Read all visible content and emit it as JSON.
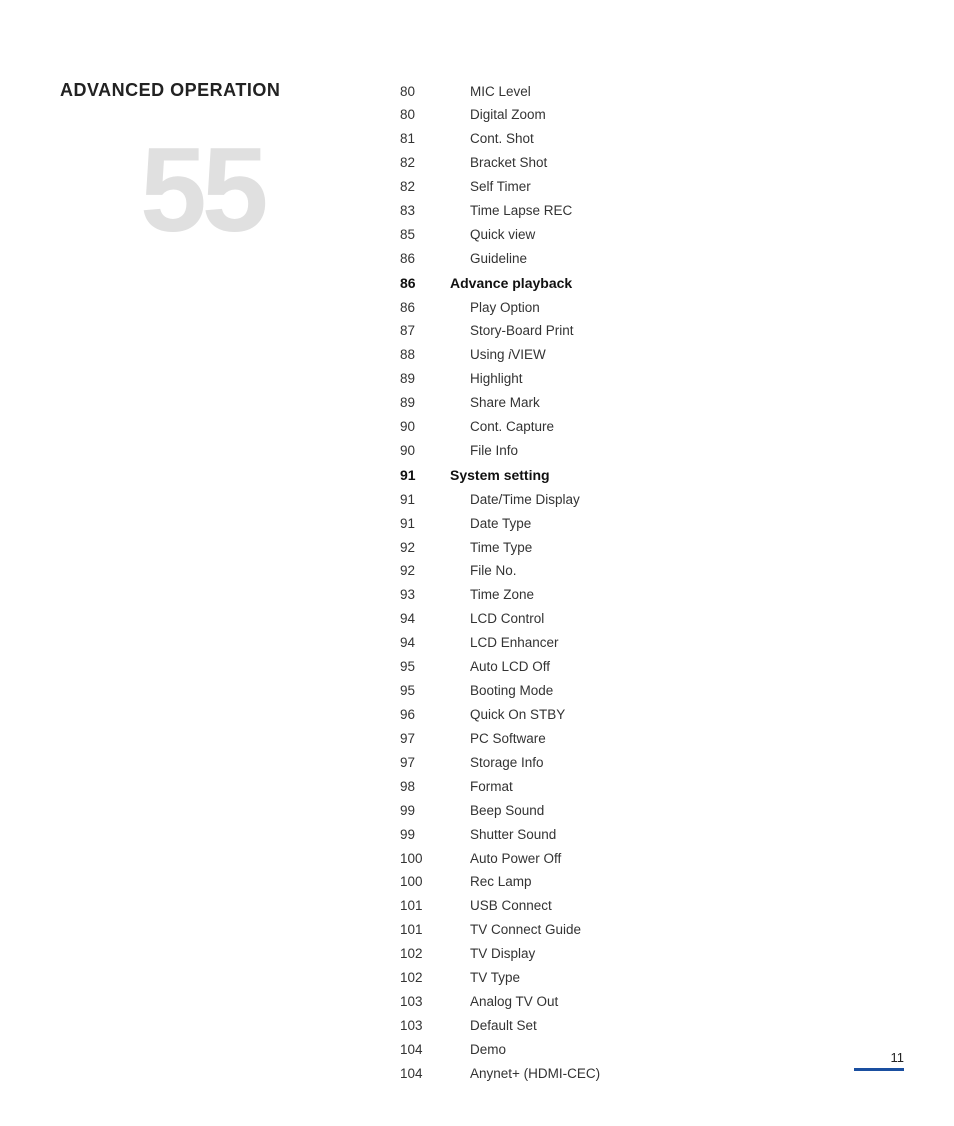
{
  "page": {
    "title": "ADVANCED OPERATION",
    "chapter": "55",
    "footer_page": "11"
  },
  "toc_items": [
    {
      "page": "80",
      "label": "MIC Level",
      "bold": false,
      "indented": true
    },
    {
      "page": "80",
      "label": "Digital Zoom",
      "bold": false,
      "indented": true
    },
    {
      "page": "81",
      "label": "Cont. Shot",
      "bold": false,
      "indented": true
    },
    {
      "page": "82",
      "label": "Bracket Shot",
      "bold": false,
      "indented": true
    },
    {
      "page": "82",
      "label": "Self Timer",
      "bold": false,
      "indented": true
    },
    {
      "page": "83",
      "label": "Time Lapse REC",
      "bold": false,
      "indented": true
    },
    {
      "page": "85",
      "label": "Quick view",
      "bold": false,
      "indented": true
    },
    {
      "page": "86",
      "label": "Guideline",
      "bold": false,
      "indented": true
    },
    {
      "page": "86",
      "label": "Advance playback",
      "bold": true,
      "indented": false
    },
    {
      "page": "86",
      "label": "Play Option",
      "bold": false,
      "indented": true
    },
    {
      "page": "87",
      "label": "Story-Board Print",
      "bold": false,
      "indented": true
    },
    {
      "page": "88",
      "label": "Using iVIEW",
      "bold": false,
      "indented": true
    },
    {
      "page": "89",
      "label": "Highlight",
      "bold": false,
      "indented": true
    },
    {
      "page": "89",
      "label": "Share Mark",
      "bold": false,
      "indented": true
    },
    {
      "page": "90",
      "label": "Cont. Capture",
      "bold": false,
      "indented": true
    },
    {
      "page": "90",
      "label": "File Info",
      "bold": false,
      "indented": true
    },
    {
      "page": "91",
      "label": "System setting",
      "bold": true,
      "indented": false
    },
    {
      "page": "91",
      "label": "Date/Time Display",
      "bold": false,
      "indented": true
    },
    {
      "page": "91",
      "label": "Date Type",
      "bold": false,
      "indented": true
    },
    {
      "page": "92",
      "label": "Time Type",
      "bold": false,
      "indented": true
    },
    {
      "page": "92",
      "label": "File No.",
      "bold": false,
      "indented": true
    },
    {
      "page": "93",
      "label": "Time Zone",
      "bold": false,
      "indented": true
    },
    {
      "page": "94",
      "label": "LCD Control",
      "bold": false,
      "indented": true
    },
    {
      "page": "94",
      "label": "LCD Enhancer",
      "bold": false,
      "indented": true
    },
    {
      "page": "95",
      "label": "Auto LCD Off",
      "bold": false,
      "indented": true
    },
    {
      "page": "95",
      "label": "Booting Mode",
      "bold": false,
      "indented": true
    },
    {
      "page": "96",
      "label": "Quick On STBY",
      "bold": false,
      "indented": true
    },
    {
      "page": "97",
      "label": "PC Software",
      "bold": false,
      "indented": true
    },
    {
      "page": "97",
      "label": "Storage Info",
      "bold": false,
      "indented": true
    },
    {
      "page": "98",
      "label": "Format",
      "bold": false,
      "indented": true
    },
    {
      "page": "99",
      "label": "Beep Sound",
      "bold": false,
      "indented": true
    },
    {
      "page": "99",
      "label": "Shutter Sound",
      "bold": false,
      "indented": true
    },
    {
      "page": "100",
      "label": "Auto Power Off",
      "bold": false,
      "indented": true
    },
    {
      "page": "100",
      "label": "Rec Lamp",
      "bold": false,
      "indented": true
    },
    {
      "page": "101",
      "label": "USB Connect",
      "bold": false,
      "indented": true
    },
    {
      "page": "101",
      "label": "TV Connect Guide",
      "bold": false,
      "indented": true
    },
    {
      "page": "102",
      "label": "TV Display",
      "bold": false,
      "indented": true
    },
    {
      "page": "102",
      "label": "TV Type",
      "bold": false,
      "indented": true
    },
    {
      "page": "103",
      "label": "Analog TV Out",
      "bold": false,
      "indented": true
    },
    {
      "page": "103",
      "label": "Default Set",
      "bold": false,
      "indented": true
    },
    {
      "page": "104",
      "label": "Demo",
      "bold": false,
      "indented": true
    },
    {
      "page": "104",
      "label": "Anynet+ (HDMI-CEC)",
      "bold": false,
      "indented": true
    }
  ]
}
